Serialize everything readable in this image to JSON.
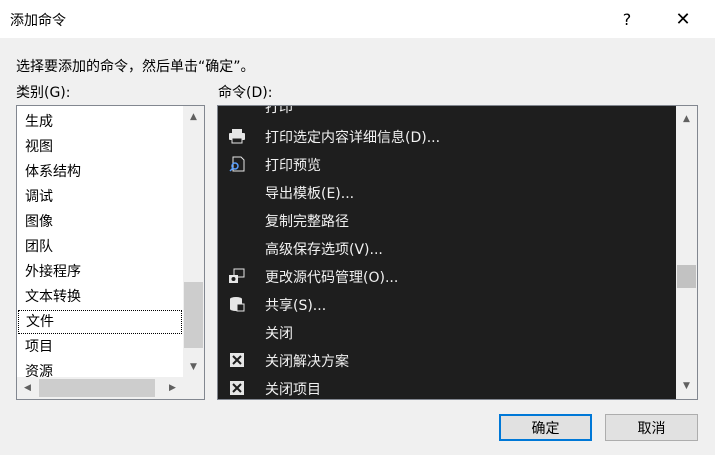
{
  "window": {
    "title": "添加命令",
    "help_symbol": "?",
    "close_symbol": "✕"
  },
  "instruction": "选择要添加的命令，然后单击“确定”。",
  "labels": {
    "categories": "类别(G):",
    "commands": "命令(D):"
  },
  "categories": {
    "items": [
      "生成",
      "视图",
      "体系结构",
      "调试",
      "图像",
      "团队",
      "外接程序",
      "文本转换",
      "文件",
      "项目",
      "资源"
    ],
    "selected": "文件"
  },
  "commands": {
    "items": [
      {
        "label": "打印",
        "icon": "none"
      },
      {
        "label": "打印选定内容详细信息(D)...",
        "icon": "printer-icon"
      },
      {
        "label": "打印预览",
        "icon": "print-preview-icon"
      },
      {
        "label": "导出模板(E)...",
        "icon": "none"
      },
      {
        "label": "复制完整路径",
        "icon": "none"
      },
      {
        "label": "高级保存选项(V)...",
        "icon": "none"
      },
      {
        "label": "更改源代码管理(O)...",
        "icon": "source-control-icon"
      },
      {
        "label": "共享(S)...",
        "icon": "share-database-icon"
      },
      {
        "label": "关闭",
        "icon": "none"
      },
      {
        "label": "关闭解决方案",
        "icon": "close-box-icon"
      },
      {
        "label": "关闭项目",
        "icon": "close-box-icon"
      }
    ]
  },
  "buttons": {
    "ok": "确定",
    "cancel": "取消"
  },
  "colors": {
    "command_bg": "#1e1e1e",
    "accent": "#0078d7"
  }
}
